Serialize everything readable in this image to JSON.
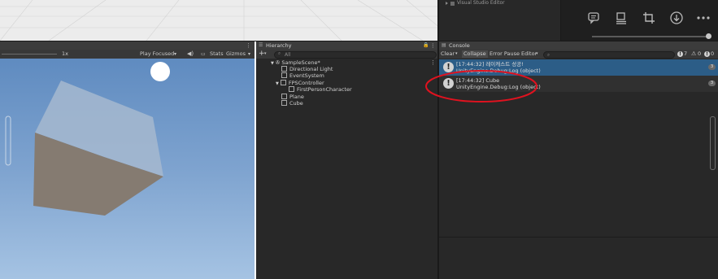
{
  "topbar": {
    "visual_studio_editor": "Visual Studio Editor",
    "icons": [
      "comment-icon",
      "layout-icon",
      "crop-icon",
      "download-icon",
      "more-icon"
    ]
  },
  "game": {
    "scale_label": "1x",
    "play_focused": "Play Focused",
    "stats": "Stats",
    "gizmos": "Gizmos"
  },
  "hierarchy": {
    "title": "Hierarchy",
    "add": "+",
    "search_placeholder": "All",
    "scene": "SampleScene*",
    "items": [
      "Directional Light",
      "EventSystem",
      "FPSController",
      "FirstPersonCharacter",
      "Plane",
      "Cube"
    ]
  },
  "console": {
    "title": "Console",
    "clear": "Clear",
    "collapse": "Collapse",
    "error_pause": "Error Pause",
    "editor": "Editor",
    "counts": {
      "log": "7",
      "warn": "0",
      "error": "0"
    },
    "entries": [
      {
        "line1": "[17:44:32] 레이캐스트 성공!",
        "line2": "UnityEngine.Debug:Log (object)",
        "count": "3",
        "selected": true
      },
      {
        "line1": "[17:44:32] Cube",
        "line2": "UnityEngine.Debug:Log (object)",
        "count": "3",
        "selected": false
      }
    ]
  },
  "colors": {
    "annotation_circle": "#e0121f",
    "selected_row": "#2c5d87",
    "sky_top": "#5f8bc0",
    "sky_bottom": "#a5c3e3"
  }
}
